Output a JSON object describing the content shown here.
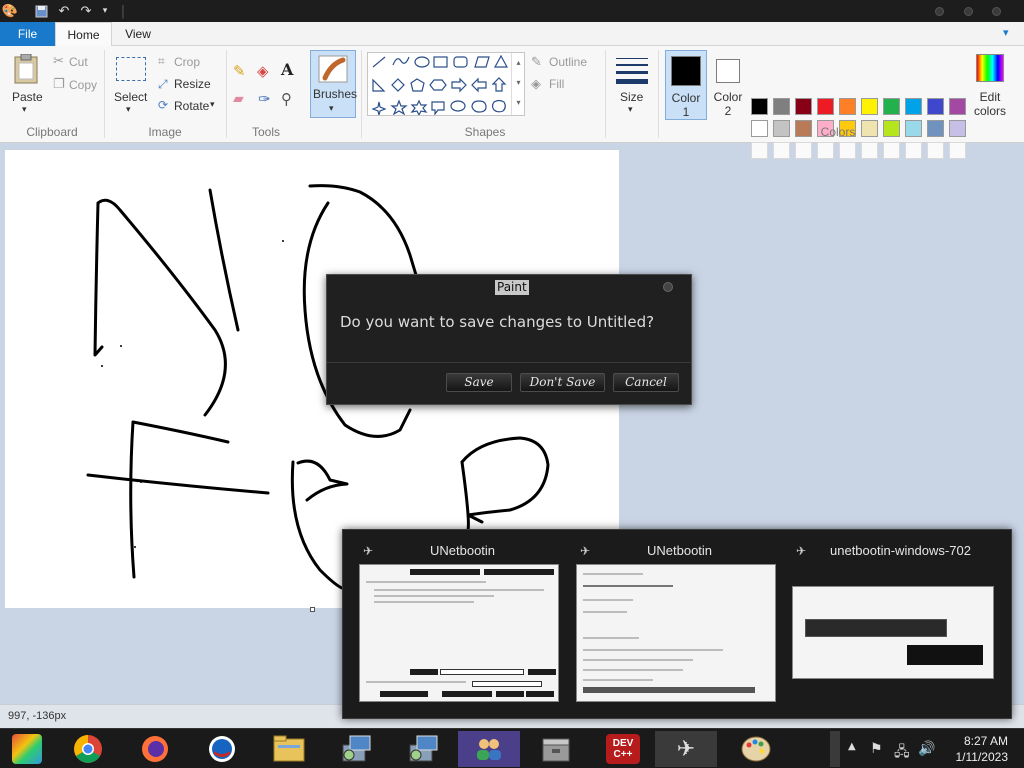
{
  "ribbon_tabs": {
    "file": "File",
    "home": "Home",
    "view": "View"
  },
  "clipboard": {
    "paste": "Paste",
    "cut": "Cut",
    "copy": "Copy",
    "group": "Clipboard"
  },
  "image": {
    "select": "Select",
    "crop": "Crop",
    "resize": "Resize",
    "rotate": "Rotate",
    "group": "Image"
  },
  "tools": {
    "group": "Tools"
  },
  "brushes": {
    "label": "Brushes"
  },
  "shapes": {
    "outline": "Outline",
    "fill": "Fill",
    "group": "Shapes"
  },
  "size": {
    "label": "Size"
  },
  "colors": {
    "color1_line1": "Color",
    "color1_line2": "1",
    "color2_line1": "Color",
    "color2_line2": "2",
    "edit_line1": "Edit",
    "edit_line2": "colors",
    "group": "Colors",
    "color1_value": "#000000",
    "color2_value": "#ffffff",
    "palette_row1": [
      "#000000",
      "#7f7f7f",
      "#880015",
      "#ed1c24",
      "#ff7f27",
      "#fff200",
      "#22b14c",
      "#00a2e8",
      "#3f48cc",
      "#a349a4"
    ],
    "palette_row2": [
      "#ffffff",
      "#c3c3c3",
      "#b97a57",
      "#ffaec9",
      "#ffc90e",
      "#efe4b0",
      "#b5e61d",
      "#99d9ea",
      "#7092be",
      "#c8bfe7"
    ]
  },
  "dialog": {
    "title": "Paint",
    "message": "Do you want to save changes to Untitled?",
    "save": "Save",
    "dont_save": "Don't Save",
    "cancel": "Cancel"
  },
  "status": {
    "coords": "997, -136px"
  },
  "thumbnails": [
    {
      "title": "UNetbootin"
    },
    {
      "title": "UNetbootin"
    },
    {
      "title": "unetbootin-windows-702"
    }
  ],
  "taskbar": {
    "items": [
      "chrome",
      "firefox",
      "opera",
      "file-explorer",
      "setup-1",
      "setup-2",
      "users",
      "installer",
      "dev-cpp",
      "unetbootin",
      "paint"
    ],
    "devcpp_label": "DEV C++",
    "time": "8:27 AM",
    "date": "1/11/2023"
  }
}
